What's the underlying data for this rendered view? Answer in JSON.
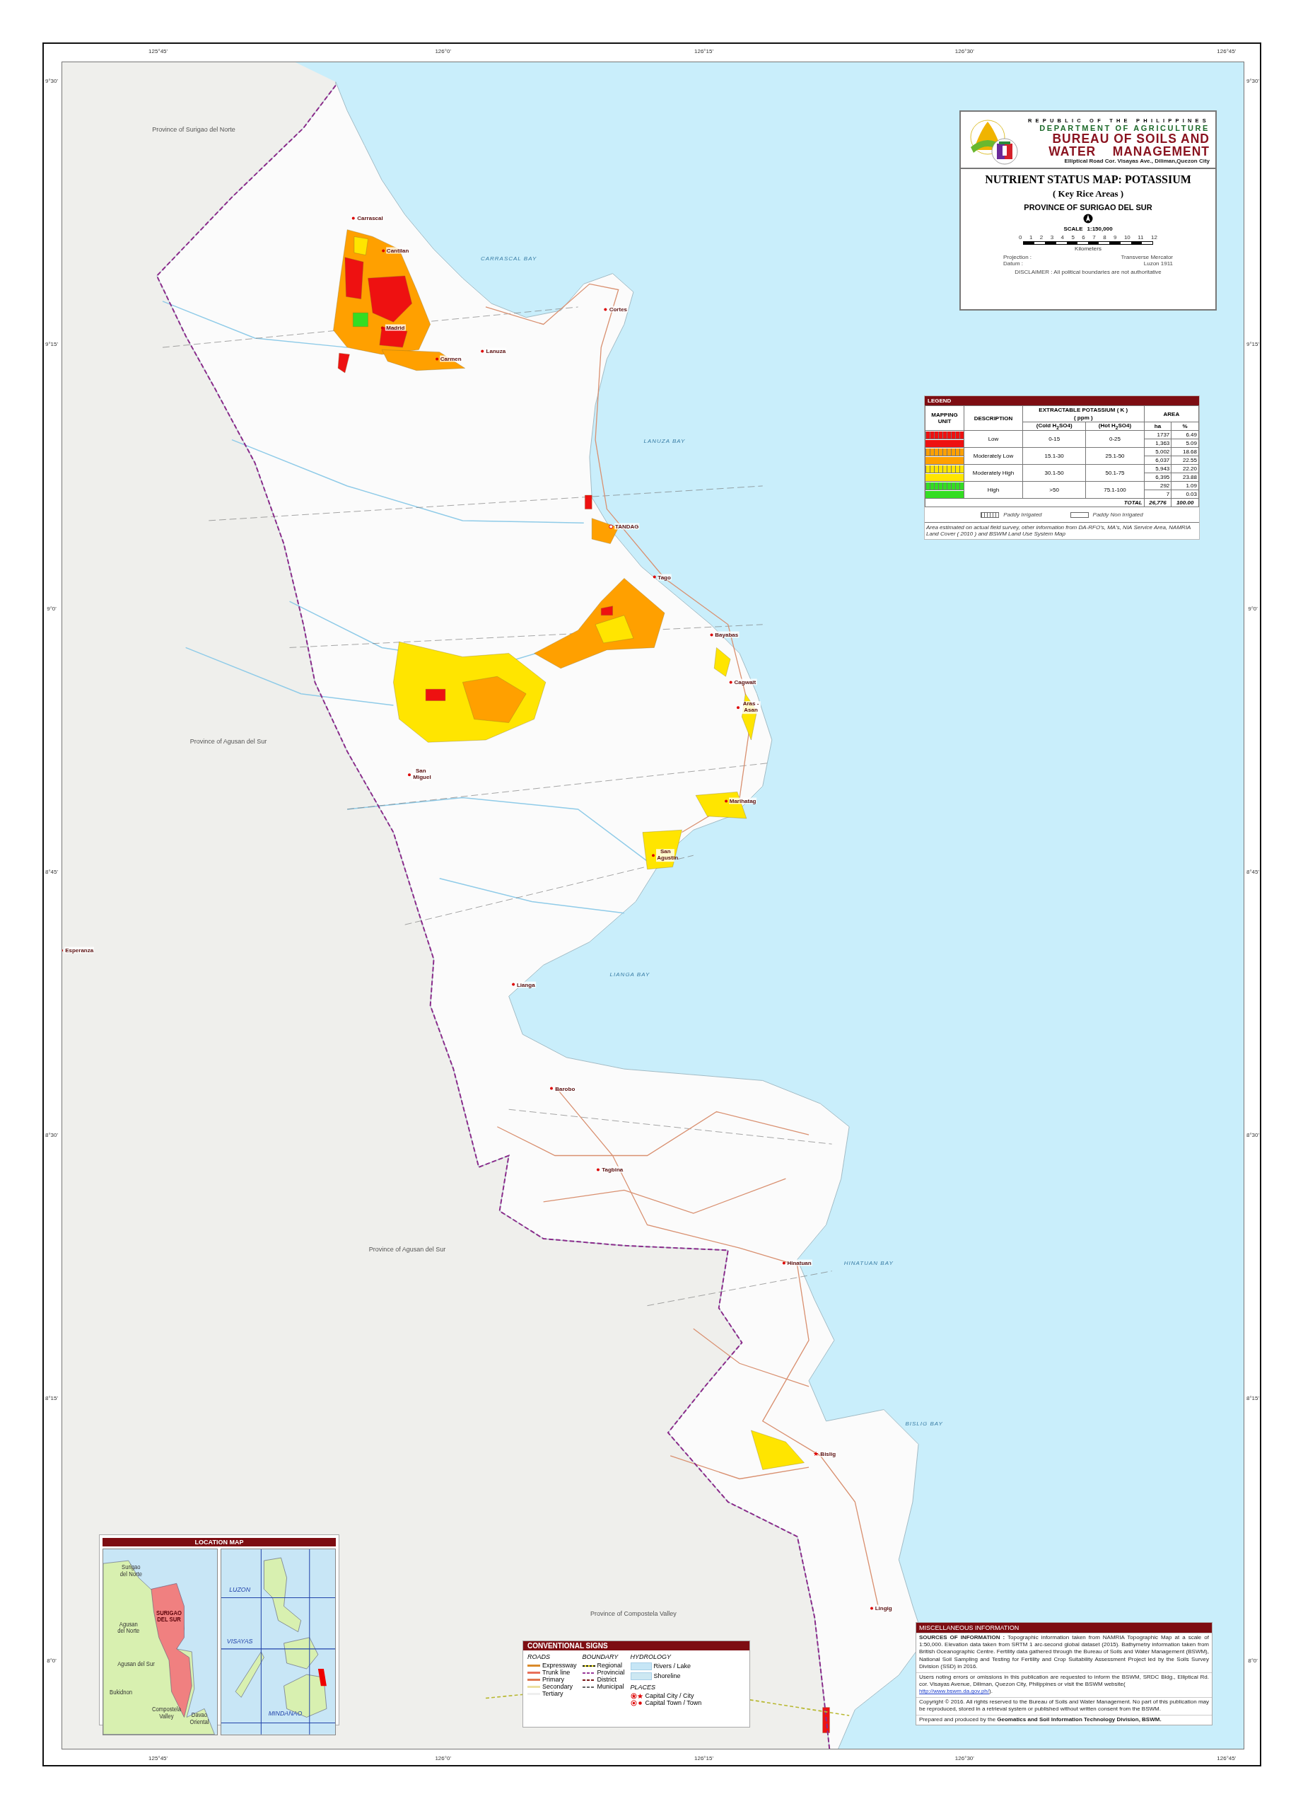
{
  "frame": {
    "top_ticks": [
      "125°45'",
      "126°0'",
      "126°15'",
      "126°30'",
      "126°45'"
    ],
    "bottom_ticks": [
      "125°45'",
      "126°0'",
      "126°15'",
      "126°30'",
      "126°45'"
    ],
    "left_ticks": [
      "9°30'",
      "9°15'",
      "9°0'",
      "8°45'",
      "8°30'",
      "8°15'",
      "8°0'"
    ],
    "right_ticks": [
      "9°30'",
      "9°15'",
      "9°0'",
      "8°45'",
      "8°30'",
      "8°15'",
      "8°0'"
    ]
  },
  "map": {
    "regions": [
      "Province of Surigao del Norte",
      "Province of Agusan del Sur",
      "Province of Agusan del Sur",
      "Province of Compostela Valley"
    ],
    "bays": [
      "CARRASCAL BAY",
      "LANUZA BAY",
      "LIANGA BAY",
      "HINATUAN BAY",
      "BISLIG BAY"
    ],
    "places": [
      {
        "name": "Esperanza",
        "kind": "town"
      },
      {
        "name": "Carrascal",
        "kind": "town"
      },
      {
        "name": "Cantilan",
        "kind": "town"
      },
      {
        "name": "Madrid",
        "kind": "town"
      },
      {
        "name": "Carmen",
        "kind": "town"
      },
      {
        "name": "Lanuza",
        "kind": "town"
      },
      {
        "name": "Cortes",
        "kind": "town"
      },
      {
        "name": "TANDAG",
        "kind": "capital"
      },
      {
        "name": "Tago",
        "kind": "town"
      },
      {
        "name": "Bayabas",
        "kind": "town"
      },
      {
        "name": "Cagwait",
        "kind": "town"
      },
      {
        "name": "Aras - Asan",
        "kind": "town"
      },
      {
        "name": "Marihatag",
        "kind": "town"
      },
      {
        "name": "San Miguel",
        "kind": "town"
      },
      {
        "name": "San Agustin",
        "kind": "town"
      },
      {
        "name": "Lianga",
        "kind": "town"
      },
      {
        "name": "Barobo",
        "kind": "town"
      },
      {
        "name": "Tagbina",
        "kind": "town"
      },
      {
        "name": "Hinatuan",
        "kind": "town"
      },
      {
        "name": "Bislig",
        "kind": "city"
      },
      {
        "name": "Lingig",
        "kind": "town"
      }
    ]
  },
  "title_block": {
    "republic": "REPUBLIC OF THE PHILIPPINES",
    "department": "DEPARTMENT OF AGRICULTURE",
    "bureau_lines": [
      "BUREAU OF SOILS AND",
      "WATER    MANAGEMENT"
    ],
    "address": "Elliptical  Road Cor. Visayas Ave., Diliman,Quezon City",
    "title": "NUTRIENT STATUS MAP: POTASSIUM",
    "subtitle": "( Key Rice Areas )",
    "province": "PROVINCE OF SURIGAO DEL SUR",
    "scale_label": "SCALE",
    "scale_value": "1:150,000",
    "scale_ticks": [
      "0",
      "1",
      "2",
      "3",
      "4",
      "5",
      "6",
      "7",
      "8",
      "9",
      "10",
      "11",
      "12"
    ],
    "scale_unit": "Kilometers",
    "info": [
      {
        "label": "Projection :",
        "value": "Transverse Mercator"
      },
      {
        "label": "Datum       :",
        "value": "Luzon 1911"
      }
    ],
    "disclaimer": "DISCLAIMER : All political boundaries are not authoritative"
  },
  "legend": {
    "header": "LEGEND",
    "columns": {
      "unit": "MAPPING UNIT",
      "description": "DESCRIPTION",
      "potassium": "EXTRACTABLE POTASSIUM ( K )",
      "ppm": "( ppm )",
      "cold": "(Cold H$_{2}$SO4)",
      "hot": "(Hot H$_{2}$SO4)",
      "area": "AREA",
      "ha": "ha",
      "pct": "%"
    },
    "classes": [
      {
        "description": "Low",
        "cold": "0-15",
        "hot": "0-25",
        "color": "#ee1111",
        "units": [
          {
            "irrigated": true,
            "ha": "1737",
            "pct": "6.49"
          },
          {
            "irrigated": false,
            "ha": "1,363",
            "pct": "5.09"
          }
        ]
      },
      {
        "description": "Moderately Low",
        "cold": "15.1-30",
        "hot": "25.1-50",
        "color": "#ffa000",
        "units": [
          {
            "irrigated": true,
            "ha": "5,002",
            "pct": "18.68"
          },
          {
            "irrigated": false,
            "ha": "6,037",
            "pct": "22.55"
          }
        ]
      },
      {
        "description": "Moderately High",
        "cold": "30.1-50",
        "hot": "50.1-75",
        "color": "#ffe500",
        "units": [
          {
            "irrigated": true,
            "ha": "5,943",
            "pct": "22.20"
          },
          {
            "irrigated": false,
            "ha": "6,395",
            "pct": "23.88"
          }
        ]
      },
      {
        "description": "High",
        "cold": ">50",
        "hot": "75.1-100",
        "color": "#33dd22",
        "units": [
          {
            "irrigated": true,
            "ha": "292",
            "pct": "1.09"
          },
          {
            "irrigated": false,
            "ha": "7",
            "pct": "0.03"
          }
        ]
      }
    ],
    "total": {
      "label": "TOTAL",
      "ha": "26,776",
      "pct": "100.00"
    },
    "key": [
      {
        "label": "Paddy Irrigated",
        "irrigated": true
      },
      {
        "label": "Paddy Non Irrigated",
        "irrigated": false
      }
    ],
    "note": "Area estimated on actual field survey, other information from DA-RFO's, MA's, NIA Service Area, NAMRIA Land Cover ( 2010 ) and BSWM Land Use System Map"
  },
  "location_map": {
    "title": "LOCATION MAP",
    "province_labels": [
      "Surigao del Norte",
      "Agusan del Norte",
      "SURIGAO DEL SUR",
      "Agusan del Sur",
      "Bukidnon",
      "Compostela Valley",
      "Davao Oriental"
    ],
    "island_labels": [
      "LUZON",
      "VISAYAS",
      "MINDANAO"
    ]
  },
  "conventional_signs": {
    "title": "CONVENTIONAL SIGNS",
    "roads": {
      "heading": "ROADS",
      "items": [
        {
          "label": "Expressway",
          "color": "#d98a2b"
        },
        {
          "label": "Trunk line",
          "color": "#e8705a"
        },
        {
          "label": "Primary",
          "color": "#e07850"
        },
        {
          "label": "Secondary",
          "color": "#ece0a0"
        },
        {
          "label": "Tertiary",
          "color": "#eeeeee"
        }
      ]
    },
    "boundary": {
      "heading": "BOUNDARY",
      "items": [
        {
          "label": "Regional",
          "color": "#222200",
          "kind": "dotted"
        },
        {
          "label": "Provincial",
          "color": "#9a3a9a",
          "kind": "dashed"
        },
        {
          "label": "District",
          "color": "#7a1a1a",
          "kind": "dashed"
        },
        {
          "label": "Municipal",
          "color": "#666666",
          "kind": "dashed"
        }
      ]
    },
    "hydrology": {
      "heading": "HYDROLOGY",
      "items": [
        {
          "label": "Rivers / Lake",
          "color": "#c6e6f6"
        },
        {
          "label": "Shoreline",
          "color": "#cde8f2"
        }
      ]
    },
    "places": {
      "heading": "PLACES",
      "items": [
        {
          "label": "Capital City / City",
          "kind": "star"
        },
        {
          "label": "Capital Town /  Town",
          "kind": "dot"
        }
      ]
    }
  },
  "misc_info": {
    "title": "MISCELLANEOUS INFORMATION",
    "paragraphs": [
      {
        "text": "**SOURCES OF INFORMATION :** Topographic information taken from NAMRIA Topographic Map at a scale of 1:50,000. Elevation data taken from SRTM 1 arc-second global dataset (2015). Bathymetry information taken from British Oceanographic Centre. Fertility data gathered through the Bureau of Soils and Water Management (BSWM), National Soil Sampling and Testing for Fertility and Crop Suitability Assessment Project led by the Soils Survey Division (SSD) in 2016."
      },
      {
        "text": "Users noting errors or omissions in this publication are requested to inform the  BSWM, SRDC Bldg., Elliptical Rd. cor. Visayas Avenue, Diliman, Quezon City, Philippines or visit the BSWM website(",
        "link": "http://www.bswm.da.gov.ph/",
        "after": ")."
      },
      {
        "text": "Copyright © 2016.  All rights reserved to the Bureau of Soils and Water Management. No part of this publication may be reproduced, stored in a retrieval system or published without written consent from the BSWM."
      },
      {
        "text": "Prepared and produced by the **Geomatics and Soil Information Technology Division, BSWM.**"
      }
    ]
  }
}
